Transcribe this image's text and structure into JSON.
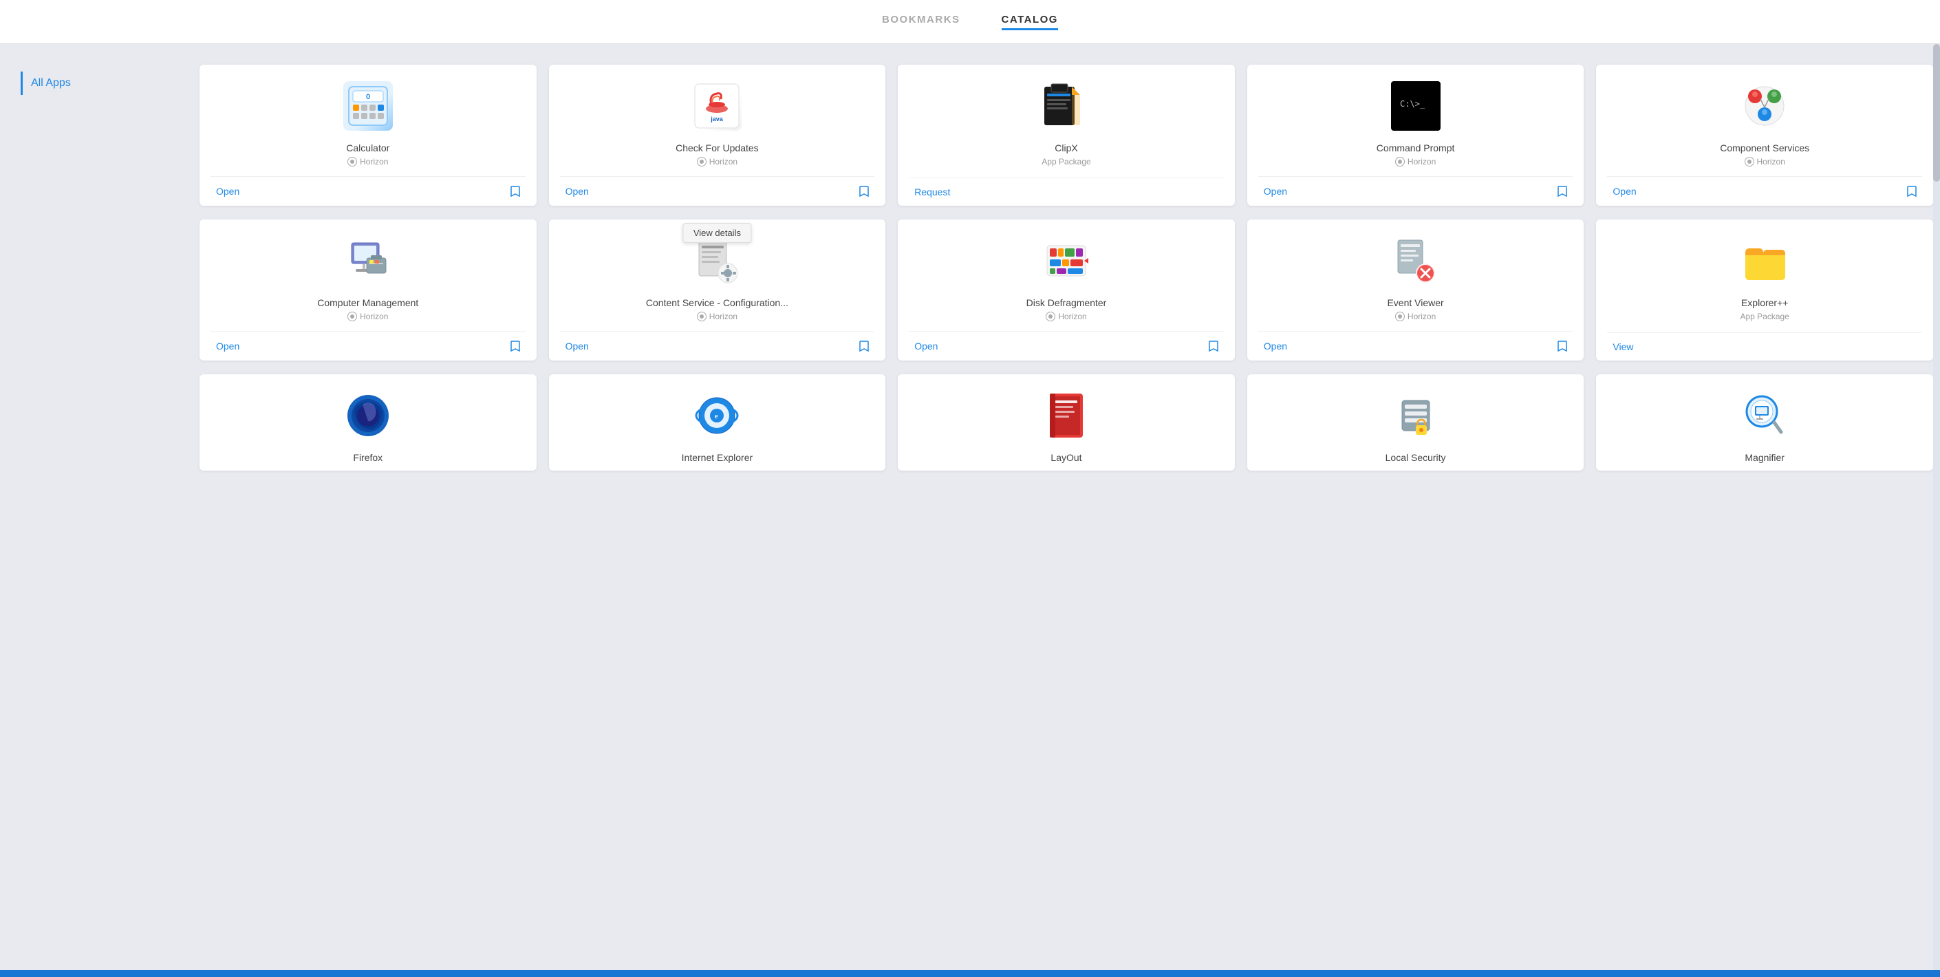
{
  "nav": {
    "tabs": [
      {
        "id": "bookmarks",
        "label": "BOOKMARKS",
        "active": false
      },
      {
        "id": "catalog",
        "label": "CATALOG",
        "active": true
      }
    ]
  },
  "sidebar": {
    "items": [
      {
        "id": "all-apps",
        "label": "All Apps",
        "active": true
      }
    ]
  },
  "row1": {
    "cards": [
      {
        "id": "calculator",
        "name": "Calculator",
        "source": "Horizon",
        "sourceType": "horizon",
        "action": "Open",
        "iconType": "calculator"
      },
      {
        "id": "check-for-updates",
        "name": "Check For Updates",
        "source": "Horizon",
        "sourceType": "horizon",
        "action": "Open",
        "iconType": "java",
        "tooltip": "View details"
      },
      {
        "id": "clipx",
        "name": "ClipX",
        "source": "App Package",
        "sourceType": "package",
        "action": "Request",
        "iconType": "clipx"
      },
      {
        "id": "command-prompt",
        "name": "Command Prompt",
        "source": "Horizon",
        "sourceType": "horizon",
        "action": "Open",
        "iconType": "cmd"
      },
      {
        "id": "component-services",
        "name": "Component Services",
        "source": "Horizon",
        "sourceType": "horizon",
        "action": "Open",
        "iconType": "compservices"
      }
    ]
  },
  "row2": {
    "cards": [
      {
        "id": "computer-management",
        "name": "Computer Management",
        "source": "Horizon",
        "sourceType": "horizon",
        "action": "Open",
        "iconType": "compmgmt"
      },
      {
        "id": "content-service-config",
        "name": "Content Service - Configuration...",
        "source": "Horizon",
        "sourceType": "horizon",
        "action": "Open",
        "iconType": "content"
      },
      {
        "id": "disk-defragmenter",
        "name": "Disk Defragmenter",
        "source": "Horizon",
        "sourceType": "horizon",
        "action": "Open",
        "iconType": "defrag"
      },
      {
        "id": "event-viewer",
        "name": "Event Viewer",
        "source": "Horizon",
        "sourceType": "horizon",
        "action": "Open",
        "iconType": "eventviewer"
      },
      {
        "id": "explorer-plus",
        "name": "Explorer++",
        "source": "App Package",
        "sourceType": "package",
        "action": "View",
        "iconType": "explorer"
      }
    ]
  },
  "row3": {
    "cards": [
      {
        "id": "firefox",
        "name": "Firefox",
        "source": "",
        "sourceType": "none",
        "action": "",
        "iconType": "firefox"
      },
      {
        "id": "internet-explorer",
        "name": "Internet Explorer",
        "source": "",
        "sourceType": "none",
        "action": "",
        "iconType": "ie"
      },
      {
        "id": "layout",
        "name": "LayOut",
        "source": "",
        "sourceType": "none",
        "action": "",
        "iconType": "layout"
      },
      {
        "id": "local-security",
        "name": "Local Security",
        "source": "",
        "sourceType": "none",
        "action": "",
        "iconType": "localsec"
      },
      {
        "id": "magnifier",
        "name": "Magnifier",
        "source": "",
        "sourceType": "none",
        "action": "",
        "iconType": "magnifier"
      }
    ]
  },
  "labels": {
    "open": "Open",
    "request": "Request",
    "view": "View",
    "all_apps": "All Apps",
    "view_details": "View details"
  }
}
